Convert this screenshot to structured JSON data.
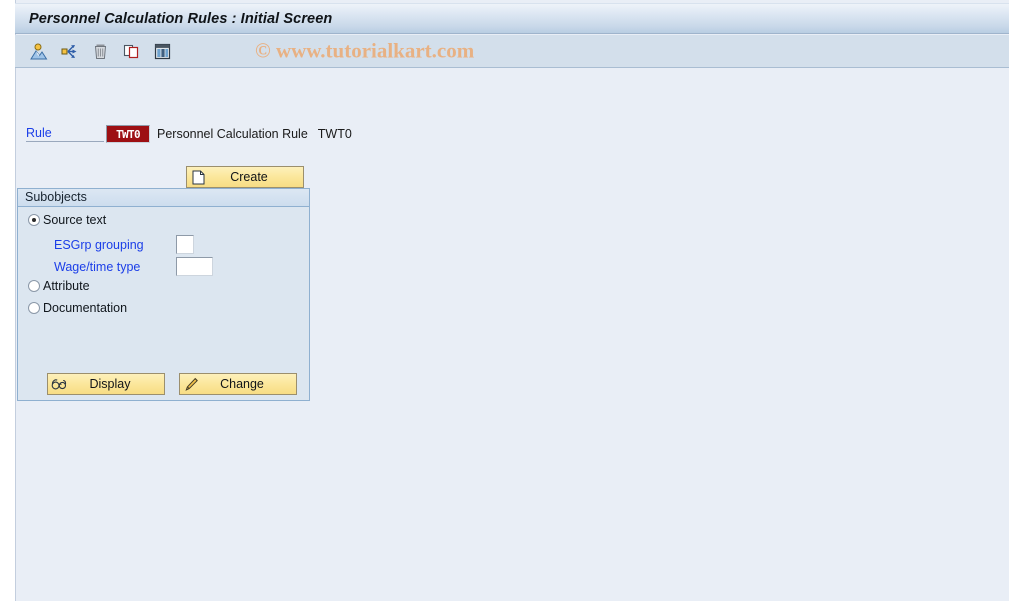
{
  "window": {
    "title": "Personnel Calculation Rules : Initial Screen"
  },
  "toolbar": {
    "watermark": "© www.tutorialkart.com",
    "icons": [
      {
        "name": "person-over-mountain-icon",
        "title": "Other object"
      },
      {
        "name": "move-arrows-icon",
        "title": "Copy / move"
      },
      {
        "name": "trash-can-icon",
        "title": "Delete"
      },
      {
        "name": "copy-pages-icon",
        "title": "Copy"
      },
      {
        "name": "grid-table-icon",
        "title": "Table view"
      }
    ]
  },
  "form": {
    "rule_label": "Rule",
    "rule_value": "TWT0",
    "rule_description": "Personnel Calculation Rule",
    "rule_code": "TWT0",
    "create_label": "Create",
    "create_icon": "document-icon"
  },
  "subobjects": {
    "title": "Subobjects",
    "options": [
      {
        "label": "Source text",
        "selected": true
      },
      {
        "label": "Attribute",
        "selected": false
      },
      {
        "label": "Documentation",
        "selected": false
      }
    ],
    "fields": [
      {
        "label": "ESGrp grouping",
        "value": "",
        "size": "small"
      },
      {
        "label": "Wage/time type",
        "value": "",
        "size": "medium"
      }
    ],
    "display_label": "Display",
    "display_icon": "glasses-icon",
    "change_label": "Change",
    "change_icon": "pencil-icon"
  },
  "colors": {
    "title_bar": "#c8d8e9",
    "toolbar": "#d3dfeb",
    "canvas": "#e9eef6",
    "group_bg": "#dce6f0",
    "button": "#f7dd84",
    "link": "#1b3ee8",
    "rule_field": "#9d0f13",
    "watermark": "#e8b183"
  }
}
